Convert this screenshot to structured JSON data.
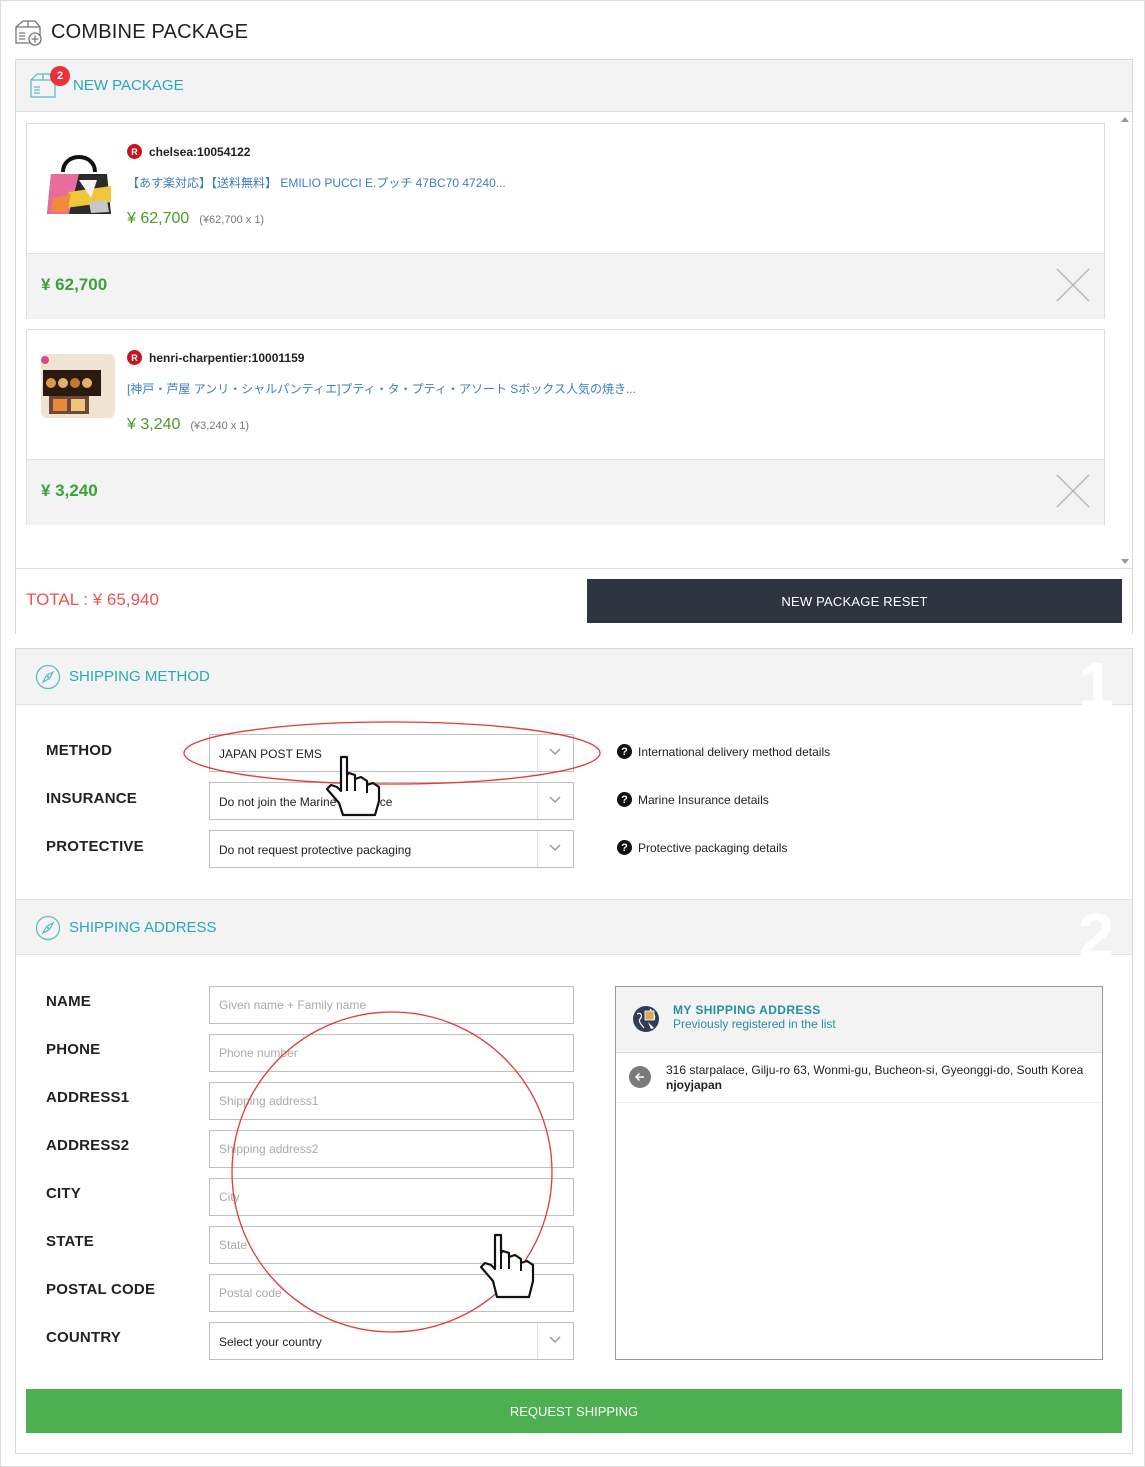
{
  "page": {
    "title": "COMBINE PACKAGE"
  },
  "new_package": {
    "label": "NEW PACKAGE",
    "badge_count": "2",
    "items": [
      {
        "shop_badge": "R",
        "shop": "chelsea:10054122",
        "title": "【あす楽対応】【送料無料】 EMILIO PUCCI E.プッチ 47BC70 47240...",
        "price": "¥ 62,700",
        "price_detail": "(¥62,700 x 1)",
        "subtotal": "¥ 62,700"
      },
      {
        "shop_badge": "R",
        "shop": "henri-charpentier:10001159",
        "title": "[神戸・芦屋 アンリ・シャルパンティエ]プティ・タ・プティ・アソート Sボックス人気の焼き...",
        "price": "¥ 3,240",
        "price_detail": "(¥3,240 x 1)",
        "subtotal": "¥ 3,240"
      }
    ],
    "total": "TOTAL : ¥ 65,940",
    "reset_label": "NEW PACKAGE RESET"
  },
  "shipping_method": {
    "label": "SHIPPING METHOD",
    "step": "1",
    "rows": [
      {
        "label": "METHOD",
        "value": "JAPAN POST EMS",
        "help": "International delivery method details"
      },
      {
        "label": "INSURANCE",
        "value": "Do not join the Marine Insurance",
        "help": "Marine Insurance details"
      },
      {
        "label": "PROTECTIVE",
        "value": "Do not request protective packaging",
        "help": "Protective packaging details"
      }
    ]
  },
  "shipping_address": {
    "label": "SHIPPING ADDRESS",
    "step": "2",
    "fields": [
      {
        "label": "NAME",
        "placeholder": "Given name + Family name"
      },
      {
        "label": "PHONE",
        "placeholder": "Phone number"
      },
      {
        "label": "ADDRESS1",
        "placeholder": "Shipping address1"
      },
      {
        "label": "ADDRESS2",
        "placeholder": "Shipping address2"
      },
      {
        "label": "CITY",
        "placeholder": "City"
      },
      {
        "label": "STATE",
        "placeholder": "State"
      },
      {
        "label": "POSTAL CODE",
        "placeholder": "Postal code"
      }
    ],
    "country": {
      "label": "COUNTRY",
      "value": "Select your country"
    },
    "my_address": {
      "title": "MY SHIPPING ADDRESS",
      "subtitle": "Previously registered in the list",
      "entries": [
        {
          "address": "316 starpalace, Gilju-ro 63, Wonmi-gu, Bucheon-si, Gyeonggi-do, South Korea",
          "name": "njoyjapan"
        }
      ]
    }
  },
  "request_label": "REQUEST SHIPPING",
  "colors": {
    "accent_teal": "#2aa7b8",
    "price_green": "#3aa23a",
    "total_red": "#ef5350",
    "dark_button": "#2f3540",
    "green_button": "#4cb050",
    "annotation_red": "#e53935"
  }
}
